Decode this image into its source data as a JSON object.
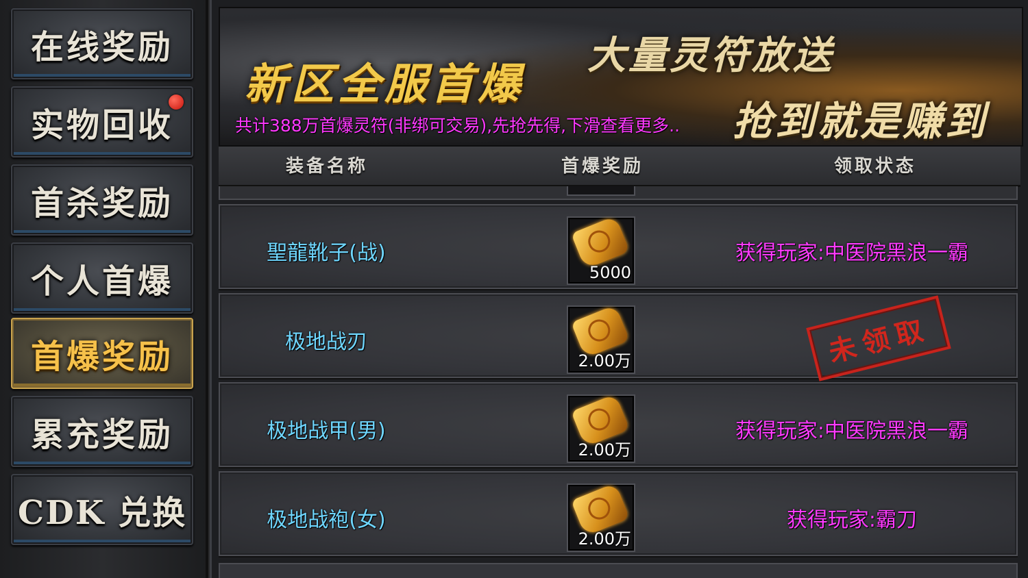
{
  "sidebar": {
    "items": [
      {
        "label": "在线奖励",
        "active": false,
        "badge": false
      },
      {
        "label": "实物回收",
        "active": false,
        "badge": true
      },
      {
        "label": "首杀奖励",
        "active": false,
        "badge": false
      },
      {
        "label": "个人首爆",
        "active": false,
        "badge": false
      },
      {
        "label": "首爆奖励",
        "active": true,
        "badge": false
      },
      {
        "label": "累充奖励",
        "active": false,
        "badge": false
      },
      {
        "label": "CDK 兑换",
        "active": false,
        "badge": false
      }
    ]
  },
  "banner": {
    "headline": "新区全服首爆",
    "slogan_top": "大量灵符放送",
    "slogan_bottom": "抢到就是赚到",
    "note": "共计388万首爆灵符(非绑可交易),先抢先得,下滑查看更多.."
  },
  "table": {
    "headers": [
      "装备名称",
      "首爆奖励",
      "领取状态"
    ],
    "rows": [
      {
        "name": "聖龍靴子(战)",
        "reward": "5000",
        "status": "获得玩家:中医院黑浪一霸",
        "stamp": ""
      },
      {
        "name": "极地战刃",
        "reward": "2.00万",
        "status": "",
        "stamp": "未领取"
      },
      {
        "name": "极地战甲(男)",
        "reward": "2.00万",
        "status": "获得玩家:中医院黑浪一霸",
        "stamp": ""
      },
      {
        "name": "极地战袍(女)",
        "reward": "2.00万",
        "status": "获得玩家:霸刀",
        "stamp": ""
      }
    ]
  },
  "colors": {
    "item_name": "#6fd7ff",
    "status_text": "#ff3bff",
    "active_tab": "#f6c14a",
    "stamp": "#d0261d"
  }
}
